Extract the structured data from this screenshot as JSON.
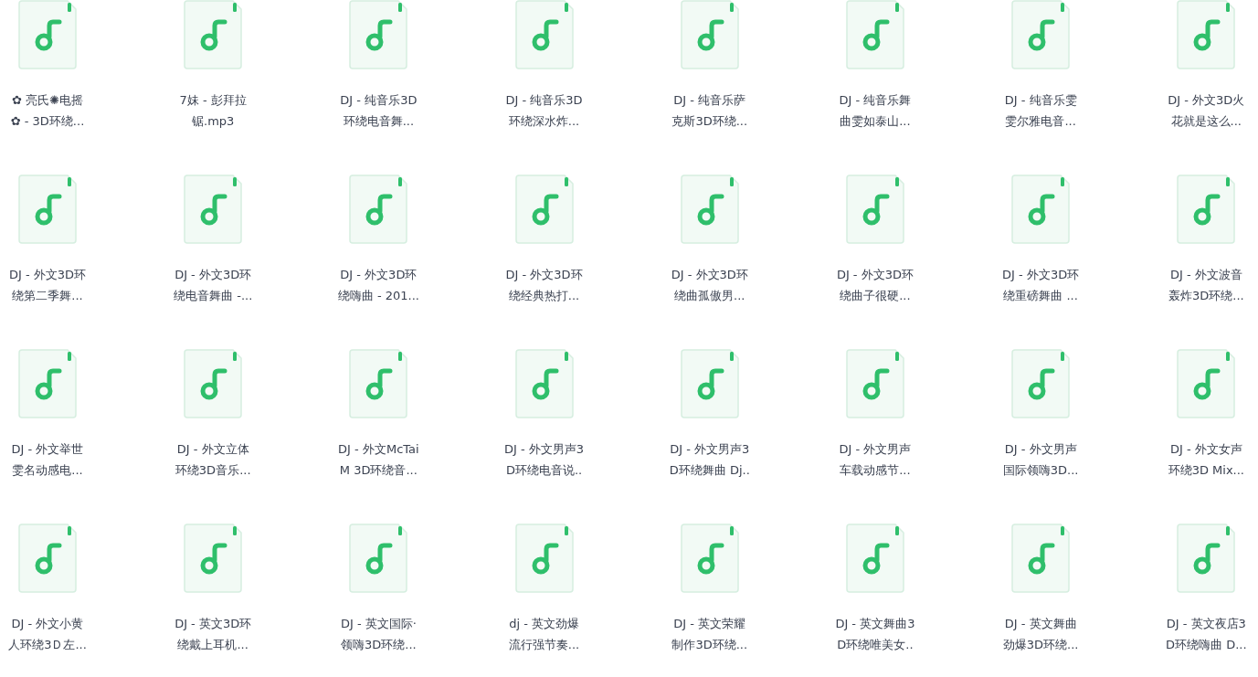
{
  "files": [
    {
      "lines": [
        "✿ 亮氏✺电摇",
        "✿ - 3D环绕..."
      ]
    },
    {
      "lines": [
        "7妹 - 彭拜拉",
        "锯.mp3"
      ]
    },
    {
      "lines": [
        "DJ - 纯音乐3D",
        "环绕电音舞..."
      ]
    },
    {
      "lines": [
        "DJ - 纯音乐3D",
        "环绕深水炸..."
      ]
    },
    {
      "lines": [
        "DJ - 纯音乐萨",
        "克斯3D环绕..."
      ]
    },
    {
      "lines": [
        "DJ - 纯音乐舞",
        "曲雯如泰山..."
      ]
    },
    {
      "lines": [
        "DJ - 纯音乐雯",
        "雯尔雅电音..."
      ]
    },
    {
      "lines": [
        "DJ - 外文3D火",
        "花就是这么..."
      ]
    },
    {
      "lines": [
        "DJ - 外文3D环",
        "绕第二季舞..."
      ]
    },
    {
      "lines": [
        "DJ - 外文3D环",
        "绕电音舞曲 -..."
      ]
    },
    {
      "lines": [
        "DJ - 外文3D环",
        "绕嗨曲 - 201..."
      ]
    },
    {
      "lines": [
        "DJ - 外文3D环",
        "绕经典热打..."
      ]
    },
    {
      "lines": [
        "DJ - 外文3D环",
        "绕曲孤傲男..."
      ]
    },
    {
      "lines": [
        "DJ - 外文3D环",
        "绕曲子很硬..."
      ]
    },
    {
      "lines": [
        "DJ - 外文3D环",
        "绕重磅舞曲 ..."
      ]
    },
    {
      "lines": [
        "DJ - 外文波音",
        "轰炸3D环绕..."
      ]
    },
    {
      "lines": [
        "DJ - 外文举世",
        "雯名动感电..."
      ]
    },
    {
      "lines": [
        "DJ - 外文立体",
        "环绕3D音乐..."
      ]
    },
    {
      "lines": [
        "DJ - 外文McTai",
        "M 3D环绕音..."
      ]
    },
    {
      "lines": [
        "DJ - 外文男声3",
        "D环绕电音说.."
      ]
    },
    {
      "lines": [
        "DJ - 外文男声3",
        "D环绕舞曲 Dj.."
      ]
    },
    {
      "lines": [
        "DJ - 外文男声",
        "车载动感节..."
      ]
    },
    {
      "lines": [
        "DJ - 外文男声",
        "国际领嗨3D..."
      ]
    },
    {
      "lines": [
        "DJ - 外文女声",
        "环绕3D Mix..."
      ]
    },
    {
      "lines": [
        "DJ - 外文小黄",
        "人环绕3Ｄ左..."
      ]
    },
    {
      "lines": [
        "DJ - 英文3D环",
        "绕戴上耳机..."
      ]
    },
    {
      "lines": [
        "DJ - 英文国际·",
        "领嗨3D环绕..."
      ]
    },
    {
      "lines": [
        "dj - 英文劲爆",
        "流行强节奏..."
      ]
    },
    {
      "lines": [
        "DJ - 英文荣耀",
        "制作3D环绕..."
      ]
    },
    {
      "lines": [
        "DJ - 英文舞曲3",
        "D环绕唯美女.."
      ]
    },
    {
      "lines": [
        "DJ - 英文舞曲",
        "劲爆3D环绕..."
      ]
    },
    {
      "lines": [
        "DJ - 英文夜店3",
        "D环绕嗨曲 D..."
      ]
    }
  ]
}
